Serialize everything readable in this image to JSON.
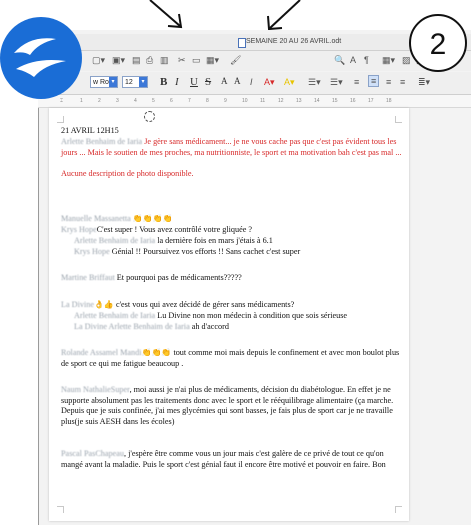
{
  "window": {
    "title": "SEMAINE 20 AU 26 AVRIL.odt"
  },
  "badge": {
    "number": "2"
  },
  "toolbar": {
    "font_name": "w Ror",
    "font_size": "12",
    "bold": "B",
    "italic": "I",
    "underline": "U",
    "strike": "S",
    "superscript": "A",
    "subscript": "A"
  },
  "ruler": {
    "marks": [
      "1",
      "2",
      "3",
      "4",
      "5",
      "6",
      "7",
      "8",
      "9",
      "10",
      "11",
      "12",
      "13",
      "14",
      "15",
      "16",
      "17",
      "18"
    ]
  },
  "doc": {
    "heading": "21 AVRIL 12H15",
    "p1_author": "Arlette Benhaim de Iaria",
    "p1_text": "Je gère sans médicament... je ne vous cache pas que c'est pas évident tous les jours ... Mais le soutien de mes proches, ma nutritionniste, le sport et ma motivation bah c'est pas mal ...",
    "p1_note": "Aucune description de photo disponible.",
    "p2_author": "Manuelle Massanetta",
    "p2_emoji": "👏👏👏👏",
    "p3_author": "Krys Hope",
    "p3_text": "C'est super ! Vous avez contrôlé votre gliquée ?",
    "p4_author": "Arlette Benhaim de Iaria",
    "p4_text": "la dernière fois en mars j'étais à 6.1",
    "p5_author": "Krys Hope",
    "p5_text": "Génial !! Poursuivez vos efforts !! Sans cachet c'est super",
    "p6_author": "Martine Briffaut",
    "p6_text": "Et pourquoi pas de médicaments?????",
    "p7_author": "La Divine",
    "p7_emoji": "👌👍",
    "p7_text": "c'est vous qui avez décidé de gérer sans médicaments?",
    "p8_author": "Arlette Benhaim de Iaria",
    "p8_text": "Lu Divine non mon médecin à condition que sois sérieuse",
    "p9_author": "La Divine Arlette Benhaim de Iaria",
    "p9_text": "ah d'accord",
    "p10_author": "Rolande Assamel Mandi",
    "p10_emoji": "👏👏👏",
    "p10_text": "tout comme moi mais depuis le confinement et avec mon boulot plus de sport ce qui me fatigue beaucoup .",
    "p11_author": "Naum NathalieSuper",
    "p11_text": ", moi aussi je n'ai plus de médicaments, décision du diabétologue. En effet je ne supporte absolument pas les traitements donc avec le sport et le rééquilibrage alimentaire (ça marche. Depuis que je suis confinée, j'ai mes glycémies qui sont basses, je fais plus de sport car je ne travaille plus(je suis AESH dans les écoles)",
    "p12_author": "Pascal PasChapeau",
    "p12_text": ", j'espère être comme vous un jour mais c'est galère de ce privé de tout ce qu'on mangé avant la maladie. Puis le sport c'est génial faut il encore être motivé et pouvoir en faire. Bon"
  },
  "colors": {
    "logo_blue": "#1a6dd6",
    "red_text": "#d72a2a",
    "font_highlight_blue": "#3c78d8"
  }
}
